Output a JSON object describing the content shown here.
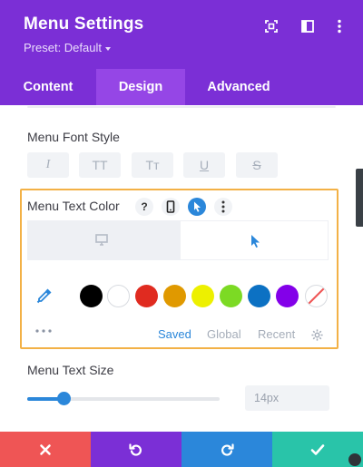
{
  "header": {
    "title": "Menu Settings",
    "preset": "Preset: Default",
    "icons": [
      "expand-icon",
      "split-view-icon",
      "more-vertical-icon"
    ]
  },
  "tabs": [
    {
      "label": "Content",
      "active": false
    },
    {
      "label": "Design",
      "active": true
    },
    {
      "label": "Advanced",
      "active": false
    }
  ],
  "font_style": {
    "label": "Menu Font Style",
    "buttons": [
      {
        "icon": "italic-icon",
        "glyph": "I"
      },
      {
        "icon": "uppercase-icon",
        "glyph": "TT"
      },
      {
        "icon": "capitalize-icon",
        "glyph": "Tт"
      },
      {
        "icon": "underline-icon",
        "glyph": "U"
      },
      {
        "icon": "strikethrough-icon",
        "glyph": "S"
      }
    ]
  },
  "text_color": {
    "label": "Menu Text Color",
    "help_glyph": "?",
    "icons": [
      "help-icon",
      "mobile-icon",
      "hover-cursor-icon",
      "more-vertical-icon"
    ],
    "device_tabs": [
      {
        "icon": "desktop-icon",
        "active": false
      },
      {
        "icon": "hover-cursor-icon",
        "active": true
      }
    ],
    "swatches": [
      "#000000",
      "#ffffff",
      "#e02b20",
      "#e09900",
      "#edf000",
      "#7cda24",
      "#0c71c3",
      "#8300e9",
      "none"
    ],
    "color_tabs": [
      {
        "label": "Saved",
        "active": true
      },
      {
        "label": "Global",
        "active": false
      },
      {
        "label": "Recent",
        "active": false
      }
    ]
  },
  "text_size": {
    "label": "Menu Text Size",
    "value": "14px",
    "slider_fraction": 0.19
  },
  "footer": {
    "buttons": [
      {
        "name": "discard-button",
        "icon": "close-icon",
        "color": "#ef5555"
      },
      {
        "name": "undo-button",
        "icon": "undo-icon",
        "color": "#7b2fd6"
      },
      {
        "name": "redo-button",
        "icon": "redo-icon",
        "color": "#2b87da"
      },
      {
        "name": "save-button",
        "icon": "check-icon",
        "color": "#29c4a9"
      }
    ]
  },
  "colors": {
    "header": "#7b2fd6",
    "active_tab": "#9546e6",
    "accent_blue": "#2b87da",
    "focus_border": "#f3b146"
  }
}
